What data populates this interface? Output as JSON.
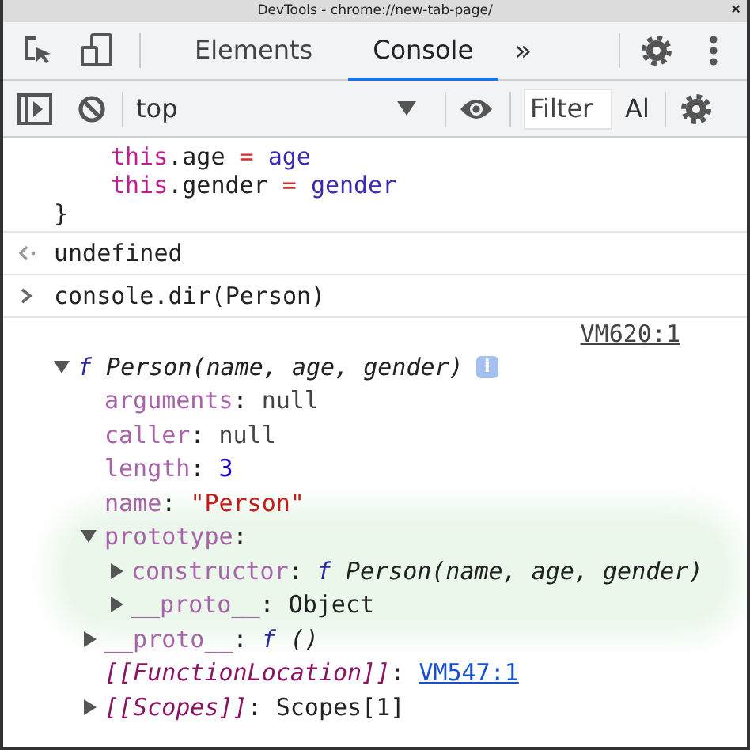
{
  "window": {
    "title": "DevTools - chrome://new-tab-page/",
    "close": "×"
  },
  "toolbar": {
    "tabs": [
      {
        "label": "Elements",
        "selected": false
      },
      {
        "label": "Console",
        "selected": true
      }
    ],
    "more": "»"
  },
  "console_toolbar": {
    "context": "top",
    "filter": {
      "placeholder": "Filter"
    },
    "levels": "Al"
  },
  "console": {
    "code_lines": [
      {
        "indented": true,
        "tokens": [
          {
            "text": "this",
            "kind": "keyword"
          },
          {
            "text": ".age ",
            "kind": "plain"
          },
          {
            "text": "= ",
            "kind": "operator"
          },
          {
            "text": "age",
            "kind": "variable"
          }
        ]
      },
      {
        "indented": true,
        "tokens": [
          {
            "text": "this",
            "kind": "keyword"
          },
          {
            "text": ".gender ",
            "kind": "plain"
          },
          {
            "text": "= ",
            "kind": "operator"
          },
          {
            "text": "gender",
            "kind": "variable"
          }
        ]
      },
      {
        "indented": false,
        "tokens": [
          {
            "text": "}",
            "kind": "plain"
          }
        ]
      }
    ],
    "entries": [
      {
        "kind": "result",
        "text": "undefined"
      },
      {
        "kind": "input",
        "text": "console.dir(Person)"
      },
      {
        "kind": "log",
        "source": "VM620:1",
        "tree": {
          "tokens": [
            {
              "text": "f",
              "kind": "fn-mark"
            },
            {
              "text": " Person(name, age, gender)",
              "kind": "fn-sig"
            }
          ],
          "info_badge": "i",
          "expanded": true,
          "children": [
            {
              "tokens": [
                {
                  "text": "arguments",
                  "kind": "key"
                },
                {
                  "text": ": ",
                  "kind": "punct"
                },
                {
                  "text": "null",
                  "kind": "null"
                }
              ]
            },
            {
              "tokens": [
                {
                  "text": "caller",
                  "kind": "key"
                },
                {
                  "text": ": ",
                  "kind": "punct"
                },
                {
                  "text": "null",
                  "kind": "null"
                }
              ]
            },
            {
              "tokens": [
                {
                  "text": "length",
                  "kind": "key"
                },
                {
                  "text": ": ",
                  "kind": "punct"
                },
                {
                  "text": "3",
                  "kind": "number"
                }
              ]
            },
            {
              "tokens": [
                {
                  "text": "name",
                  "kind": "key"
                },
                {
                  "text": ": ",
                  "kind": "punct"
                },
                {
                  "text": "\"Person\"",
                  "kind": "string"
                }
              ]
            },
            {
              "tokens": [
                {
                  "text": "prototype",
                  "kind": "key"
                },
                {
                  "text": ":",
                  "kind": "punct"
                }
              ],
              "expanded": true,
              "highlighted": true,
              "children": [
                {
                  "tokens": [
                    {
                      "text": "constructor",
                      "kind": "key"
                    },
                    {
                      "text": ": ",
                      "kind": "punct"
                    },
                    {
                      "text": "f",
                      "kind": "fn-mark"
                    },
                    {
                      "text": " Person(name, age, gender)",
                      "kind": "fn-sig"
                    }
                  ],
                  "expanded": false
                },
                {
                  "tokens": [
                    {
                      "text": "__proto__",
                      "kind": "key"
                    },
                    {
                      "text": ": ",
                      "kind": "punct"
                    },
                    {
                      "text": "Object",
                      "kind": "object"
                    }
                  ],
                  "expanded": false
                }
              ]
            },
            {
              "tokens": [
                {
                  "text": "__proto__",
                  "kind": "key"
                },
                {
                  "text": ": ",
                  "kind": "punct"
                },
                {
                  "text": "f",
                  "kind": "fn-mark"
                },
                {
                  "text": " ()",
                  "kind": "fn-sig"
                }
              ],
              "expanded": false
            },
            {
              "tokens": [
                {
                  "text": "[[FunctionLocation]]",
                  "kind": "key-internal"
                },
                {
                  "text": ": ",
                  "kind": "punct"
                },
                {
                  "text": "VM547:1",
                  "kind": "link"
                }
              ]
            },
            {
              "tokens": [
                {
                  "text": "[[Scopes]]",
                  "kind": "key-internal"
                },
                {
                  "text": ": ",
                  "kind": "punct"
                },
                {
                  "text": "Scopes[1]",
                  "kind": "object"
                }
              ],
              "expanded": false
            }
          ]
        }
      }
    ]
  }
}
